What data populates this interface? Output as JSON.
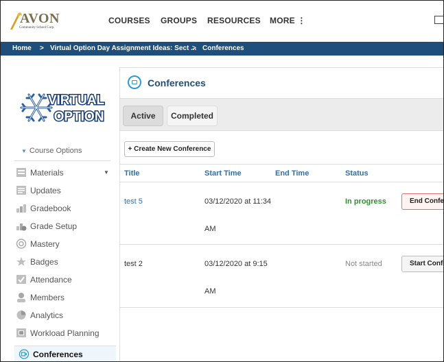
{
  "nav": {
    "brand": "AVON",
    "brand_sub": "Community School Corp.",
    "courses": "COURSES",
    "groups": "GROUPS",
    "resources": "RESOURCES",
    "more": "MORE ⋮"
  },
  "breadcrumb": {
    "home": "Home",
    "sep": ">",
    "course": "Virtual Option Day Assignment Ideas: Sect ...",
    "current": "Conferences"
  },
  "sidebar": {
    "course_logo_line1": "VIRTUAL",
    "course_logo_line2": "OPTION",
    "course_options": "Course Options",
    "items": [
      {
        "label": "Materials",
        "icon": "materials-icon"
      },
      {
        "label": "Updates",
        "icon": "updates-icon"
      },
      {
        "label": "Gradebook",
        "icon": "gradebook-icon"
      },
      {
        "label": "Grade Setup",
        "icon": "grade-setup-icon"
      },
      {
        "label": "Mastery",
        "icon": "mastery-icon"
      },
      {
        "label": "Badges",
        "icon": "badges-icon"
      },
      {
        "label": "Attendance",
        "icon": "attendance-icon"
      },
      {
        "label": "Members",
        "icon": "members-icon"
      },
      {
        "label": "Analytics",
        "icon": "analytics-icon"
      },
      {
        "label": "Workload Planning",
        "icon": "workload-icon"
      },
      {
        "label": "Conferences",
        "icon": "conference-icon"
      }
    ]
  },
  "main": {
    "title": "Conferences",
    "tabs": [
      {
        "label": "Active",
        "selected": true
      },
      {
        "label": "Completed",
        "selected": false
      }
    ],
    "create_button": "+ Create New Conference",
    "columns": [
      "Title",
      "Start Time",
      "End Time",
      "Status"
    ],
    "rows": [
      {
        "title": "test 5",
        "start_line1": "03/12/2020 at 11:34",
        "start_line2": "AM",
        "end": "",
        "status": "In progress",
        "action": "End Conference"
      },
      {
        "title": "test 2",
        "start_line1": "03/12/2020 at 9:15",
        "start_line2": "AM",
        "end": "",
        "status": "Not started",
        "action": "Start Conference"
      }
    ]
  },
  "colors": {
    "breadcrumb_bg": "#1d4e7c",
    "link": "#2c6fb0",
    "in_progress": "#2f8f2f",
    "accent": "#2b9bd6"
  }
}
